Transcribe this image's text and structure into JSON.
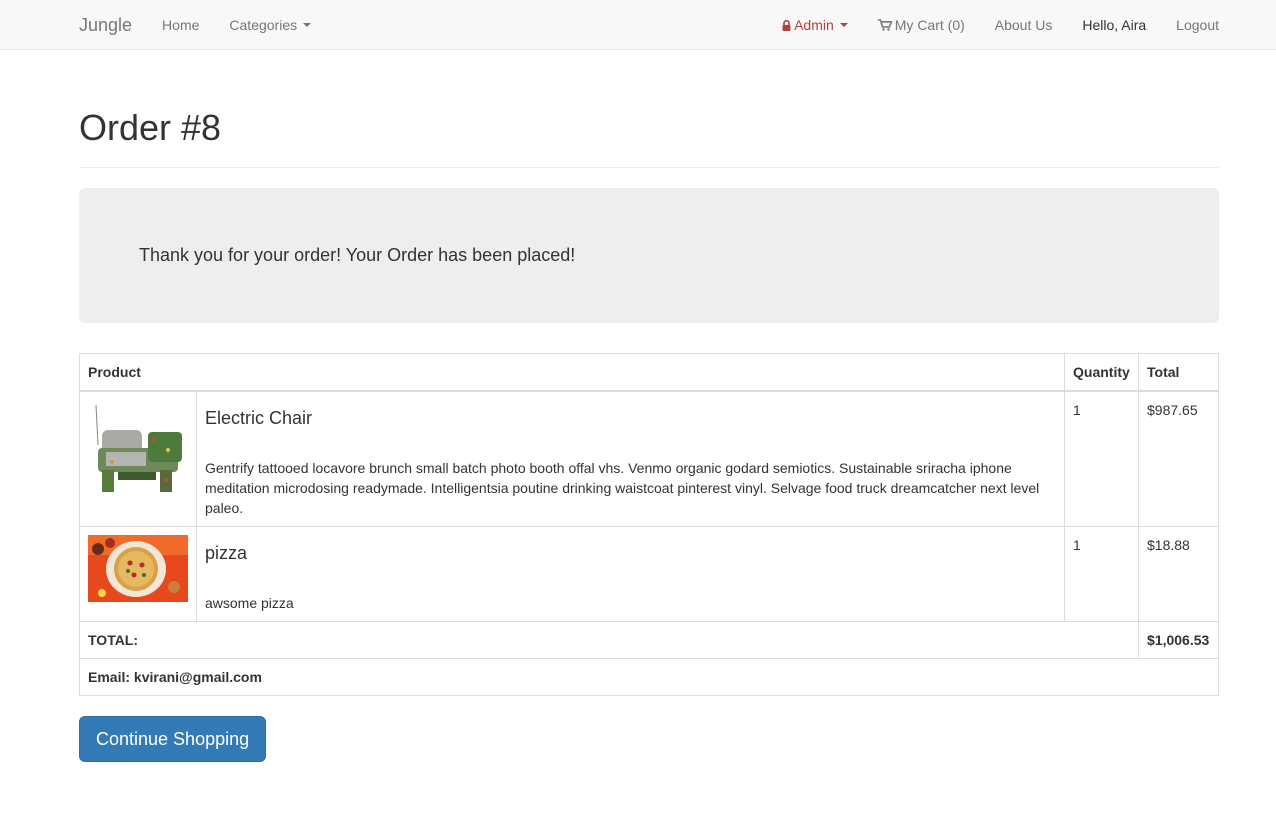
{
  "navbar": {
    "brand": "Jungle",
    "home": "Home",
    "categories": "Categories",
    "admin": "Admin",
    "cart": "My Cart (0)",
    "about": "About Us",
    "hello": "Hello, Aira",
    "logout": "Logout"
  },
  "page": {
    "title": "Order #8",
    "message": "Thank you for your order! Your Order has been placed!"
  },
  "table": {
    "headers": {
      "product": "Product",
      "quantity": "Quantity",
      "total": "Total"
    },
    "items": [
      {
        "name": "Electric Chair",
        "description": "Gentrify tattooed locavore brunch small batch photo booth offal vhs. Venmo organic godard semiotics. Sustainable sriracha iphone meditation microdosing readymade. Intelligentsia poutine drinking waistcoat pinterest vinyl. Selvage food truck dreamcatcher next level paleo.",
        "quantity": "1",
        "total": "$987.65"
      },
      {
        "name": "pizza",
        "description": "awsome pizza",
        "quantity": "1",
        "total": "$18.88"
      }
    ],
    "total_label": "TOTAL:",
    "total_value": "$1,006.53",
    "email": "Email: kvirani@gmail.com"
  },
  "continue_button": "Continue Shopping",
  "colors": {
    "primary": "#337ab7",
    "admin": "#a94442",
    "jumbotron": "#eeeeee"
  },
  "icons": {
    "admin": "lock-icon",
    "cart": "shopping-cart-icon"
  }
}
